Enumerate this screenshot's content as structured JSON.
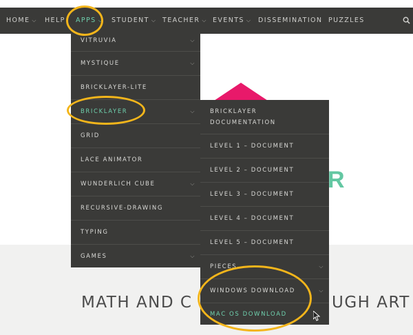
{
  "navbar": {
    "items": [
      {
        "label": "HOME",
        "has_chevron": true
      },
      {
        "label": "HELP",
        "has_chevron": false
      },
      {
        "label": "APPS",
        "has_chevron": true,
        "active": true
      },
      {
        "label": "STUDENT",
        "has_chevron": true
      },
      {
        "label": "TEACHER",
        "has_chevron": true
      },
      {
        "label": "EVENTS",
        "has_chevron": true
      },
      {
        "label": "DISSEMINATION",
        "has_chevron": false
      },
      {
        "label": "PUZZLES",
        "has_chevron": false
      }
    ],
    "search_icon": "search-icon"
  },
  "apps_menu": {
    "items": [
      {
        "label": "VITRUVIA",
        "has_submenu": true
      },
      {
        "label": "MYSTIQUE",
        "has_submenu": true
      },
      {
        "label": "BRICKLAYER-LITE",
        "has_submenu": false
      },
      {
        "label": "BRICKLAYER",
        "has_submenu": true,
        "active": true
      },
      {
        "label": "GRID",
        "has_submenu": false
      },
      {
        "label": "LACE ANIMATOR",
        "has_submenu": false
      },
      {
        "label": "WUNDERLICH CUBE",
        "has_submenu": true
      },
      {
        "label": "RECURSIVE-DRAWING",
        "has_submenu": false
      },
      {
        "label": "TYPING",
        "has_submenu": false
      },
      {
        "label": "GAMES",
        "has_submenu": true
      }
    ]
  },
  "bricklayer_menu": {
    "items": [
      {
        "label": "BRICKLAYER DOCUMENTATION",
        "has_submenu": false
      },
      {
        "label": "LEVEL 1 – DOCUMENT",
        "has_submenu": false
      },
      {
        "label": "LEVEL 2 – DOCUMENT",
        "has_submenu": false
      },
      {
        "label": "LEVEL 3 – DOCUMENT",
        "has_submenu": false
      },
      {
        "label": "LEVEL 4 – DOCUMENT",
        "has_submenu": false
      },
      {
        "label": "LEVEL 5 – DOCUMENT",
        "has_submenu": false
      },
      {
        "label": "PIECES",
        "has_submenu": true
      },
      {
        "label": "WINDOWS DOWNLOAD",
        "has_submenu": true
      },
      {
        "label": "MAC OS DOWNLOAD",
        "has_submenu": false,
        "highlight": true
      }
    ]
  },
  "hero": {
    "letter": "R",
    "tagline_left": "MATH AND C",
    "tagline_right": "UGH ART"
  },
  "colors": {
    "nav_bg": "#3a3a38",
    "accent_green": "#6fd0ad",
    "annotation_orange": "#f3b51b",
    "logo_pink": "#e8196a",
    "logo_yellow": "#f7c21c"
  }
}
